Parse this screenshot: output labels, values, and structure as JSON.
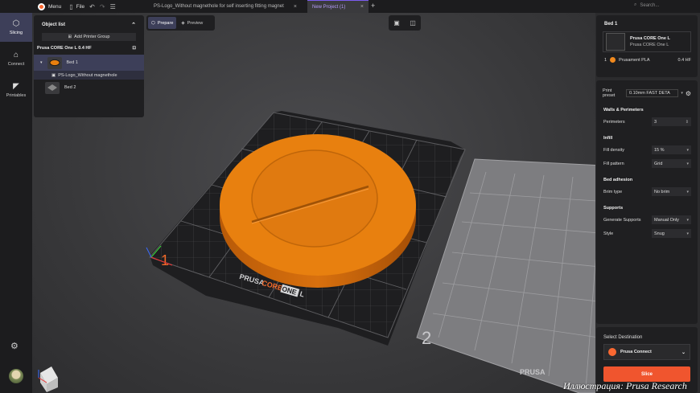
{
  "titlebar": {
    "menu_label": "Menu",
    "file_label": "File",
    "tabs": [
      {
        "label": "PS-Logo_Without magnethole for self inserting fitting magnet"
      },
      {
        "label": "New Project (1)"
      }
    ],
    "search_placeholder": "Search..."
  },
  "rail": {
    "items": [
      {
        "label": "Slicing",
        "icon": "cube-icon"
      },
      {
        "label": "Connect",
        "icon": "printer-icon"
      },
      {
        "label": "Printables",
        "icon": "printables-icon"
      }
    ]
  },
  "object_list": {
    "title": "Object list",
    "add_group": "Add Printer Group",
    "printer": "Prusa CORE One L 0.4 HF",
    "rows": [
      {
        "label": "Bed 1"
      },
      {
        "label": "PS-Logo_Without magnethole"
      },
      {
        "label": "Bed 2"
      }
    ]
  },
  "modes": {
    "prepare": "Prepare",
    "preview": "Preview"
  },
  "scene": {
    "bed1_number": "1",
    "bed2_number": "2",
    "plate_brand": "PRUSA",
    "plate_model": "CORE",
    "plate_one": "ONE",
    "plate_l": "L"
  },
  "bed_panel": {
    "title": "Bed 1",
    "printer_name": "Prusa CORE One L",
    "printer_sub": "Prusa CORE One L",
    "filament_index": "1",
    "filament_name": "Prusament PLA",
    "filament_color": "#f0891e",
    "nozzle": "0.4 HF"
  },
  "settings": {
    "preset_label": "Print preset",
    "preset_value": "0.10mm FAST DETA",
    "walls_title": "Walls & Perimeters",
    "perimeters_label": "Perimeters",
    "perimeters_value": "3",
    "infill_title": "Infill",
    "fill_density_label": "Fill density",
    "fill_density_value": "15 %",
    "fill_pattern_label": "Fill pattern",
    "fill_pattern_value": "Grid",
    "bed_adhesion_title": "Bed adhesion",
    "brim_label": "Brim type",
    "brim_value": "No brim",
    "supports_title": "Supports",
    "gen_supports_label": "Generate Supports",
    "gen_supports_value": "Manual Only",
    "style_label": "Style",
    "style_value": "Snug"
  },
  "destination": {
    "label": "Select Destination",
    "value": "Prusa Connect",
    "slice": "Slice"
  },
  "watermark": "Иллюстрация: Prusa Research",
  "colors": {
    "accent": "#f0552e",
    "selection": "#3d3f59",
    "model": "#e07814"
  }
}
